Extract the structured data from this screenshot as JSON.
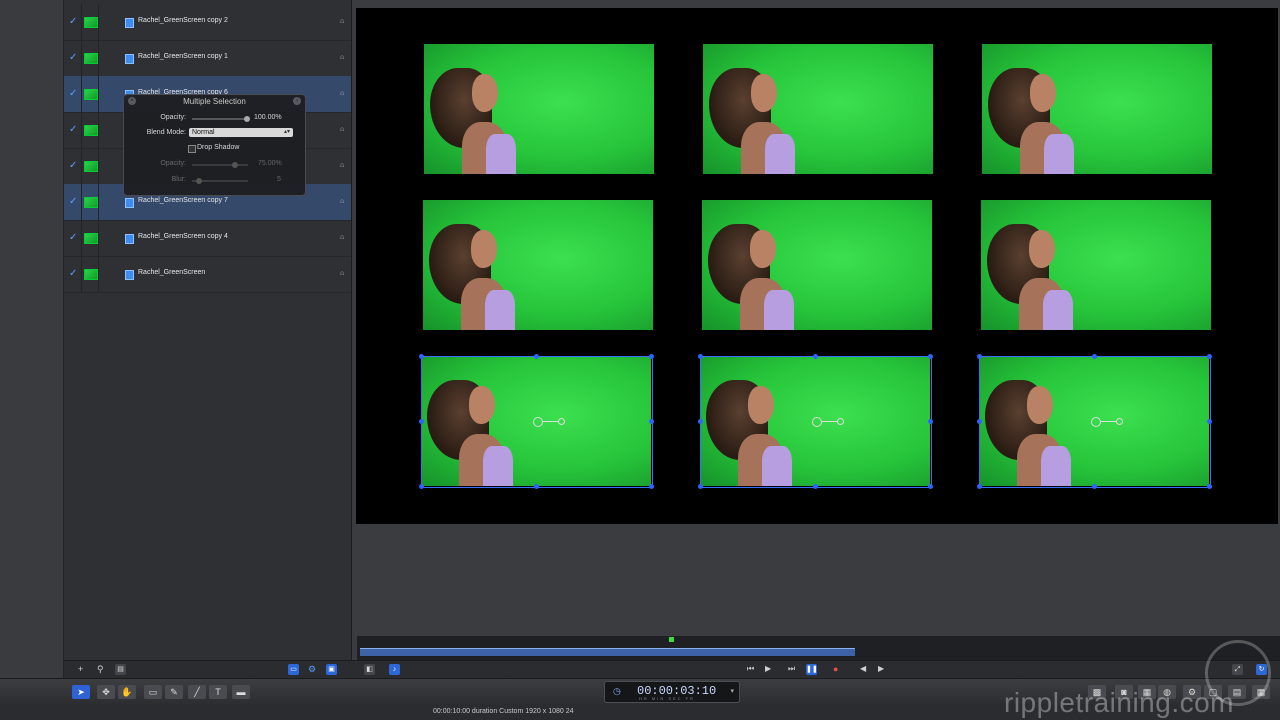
{
  "layers": [
    {
      "name": "Rachel_GreenScreen copy 2",
      "selected": false
    },
    {
      "name": "Rachel_GreenScreen copy 1",
      "selected": false
    },
    {
      "name": "Rachel_GreenScreen copy 6",
      "selected": true
    },
    {
      "name": "",
      "selected": false
    },
    {
      "name": "",
      "selected": false
    },
    {
      "name": "Rachel_GreenScreen copy 7",
      "selected": true
    },
    {
      "name": "Rachel_GreenScreen copy 4",
      "selected": false
    },
    {
      "name": "Rachel_GreenScreen",
      "selected": false
    }
  ],
  "hud": {
    "title": "Multiple Selection",
    "opacity_label": "Opacity:",
    "opacity_value": "100.00%",
    "opacity_level": 1.0,
    "blend_label": "Blend Mode:",
    "blend_value": "Normal",
    "drop_shadow_label": "Drop Shadow",
    "shadow_opacity_label": "Opacity:",
    "shadow_opacity_value": "75.00%",
    "blur_label": "Blur:",
    "blur_value": "5"
  },
  "timecode": {
    "value": "00:00:03:10",
    "sub": "HR MIN SEC FR"
  },
  "status": "00:00:10:00 duration Custom 1920 x 1080 24",
  "watermark": "rippletraining.com",
  "icons": {
    "check": "✓",
    "lock": "🔒",
    "add": "+",
    "search": "⚲",
    "play": "▶",
    "pause": "❚❚",
    "rewind": "⏮",
    "record": "●",
    "gear": "⚙",
    "text_tool": "T"
  },
  "colors": {
    "selection": "#2f63ff",
    "green_screen": "#26c43a",
    "panel": "#2f3034"
  }
}
